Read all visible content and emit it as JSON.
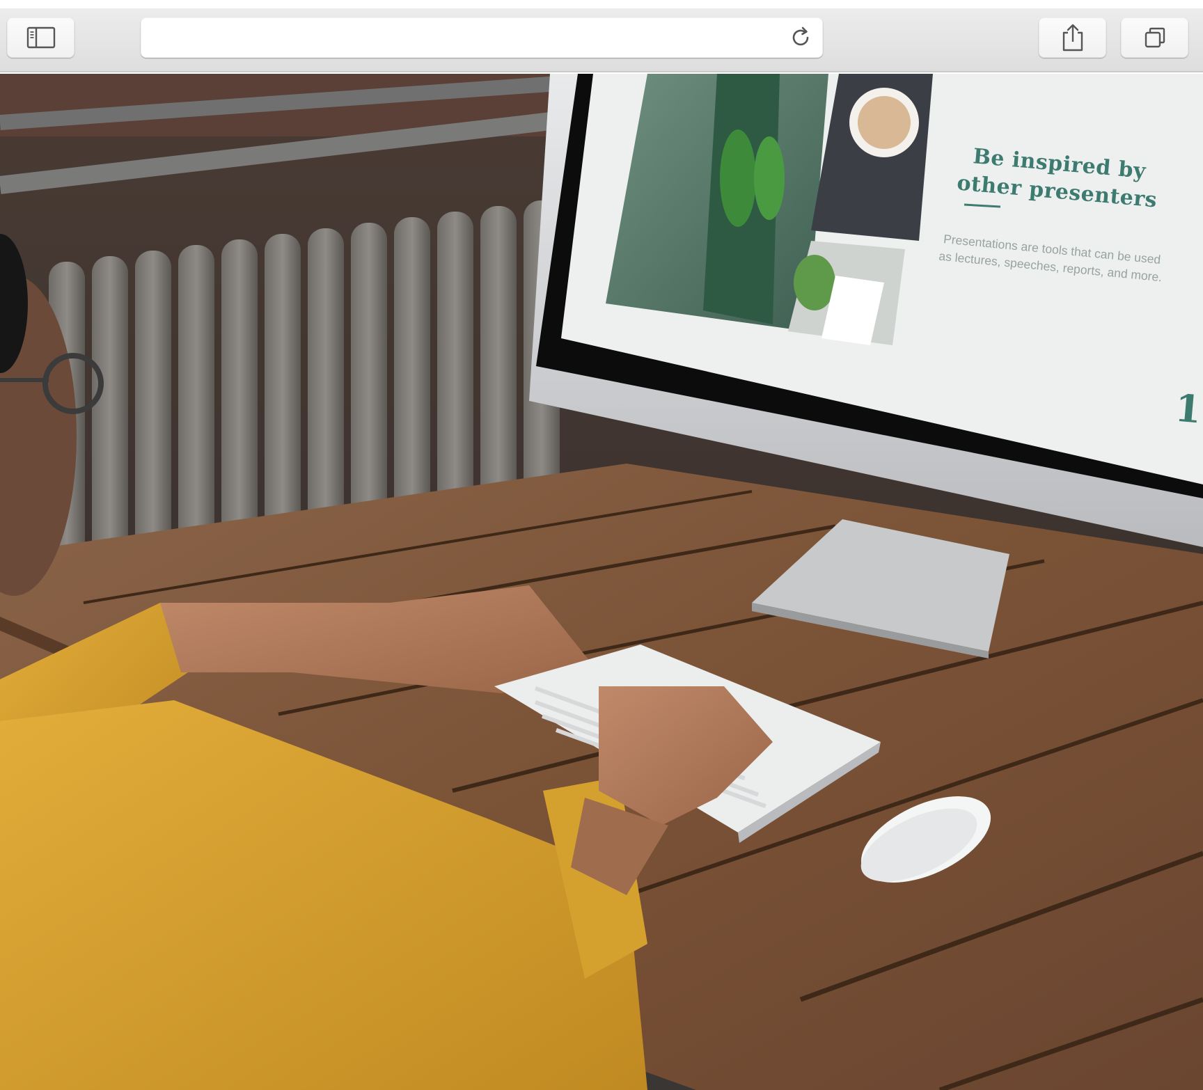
{
  "browser": {
    "address_value": "",
    "address_placeholder": "",
    "icons": {
      "sidebar": "sidebar-icon",
      "reload": "reload-icon",
      "share": "share-icon",
      "tabs": "tabs-icon"
    }
  },
  "slide": {
    "heading": "Be inspired by other presenters",
    "body": "Presentations are tools that can be used as lectures, speeches, reports, and more.",
    "page_number": "1"
  },
  "colors": {
    "toolbar": "#e6e6e6",
    "slide_accent": "#3d7a70",
    "slide_text": "#96a3a2",
    "shirt": "#d9a22e",
    "wood": "#7a5236"
  }
}
